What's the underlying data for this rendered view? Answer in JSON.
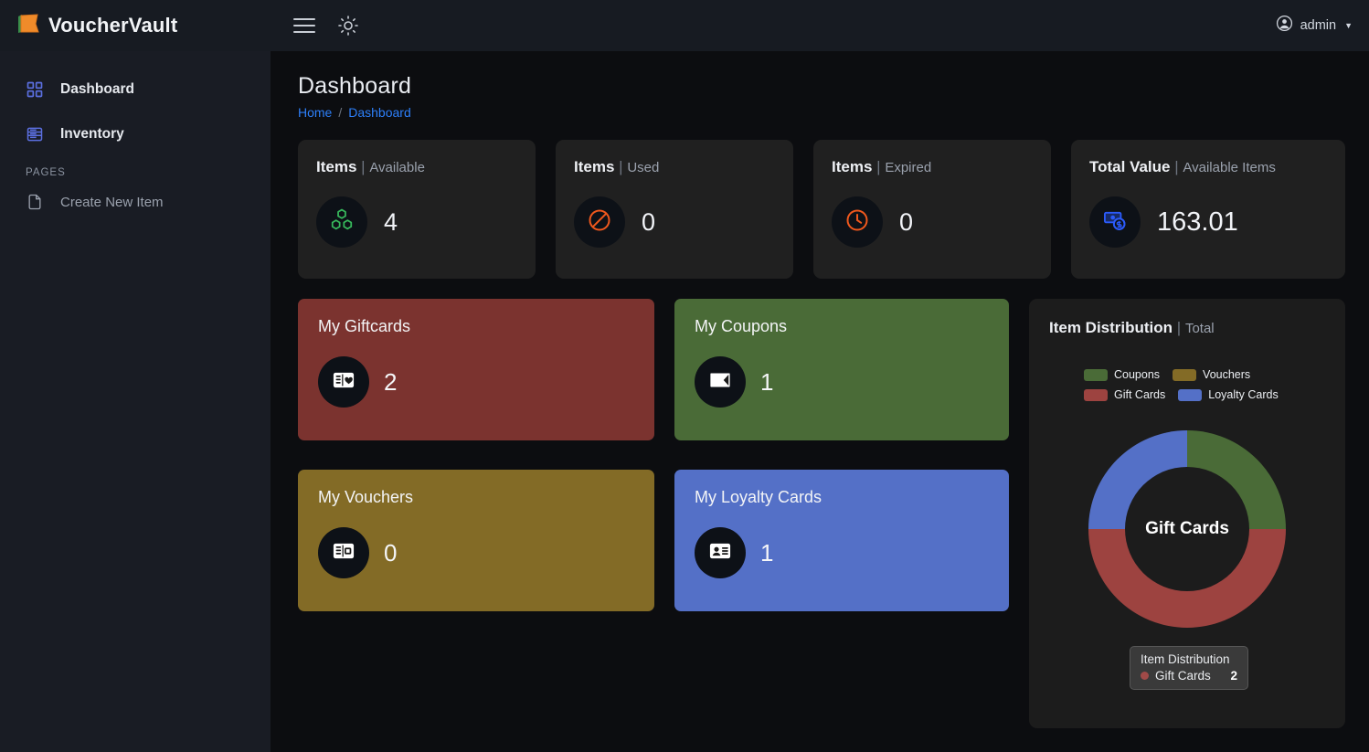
{
  "brand": {
    "logo_icon": "voucher-flag-icon",
    "name": "VoucherVault"
  },
  "topbar": {
    "menu_icon": "hamburger-menu-icon",
    "theme_icon": "sun-theme-icon",
    "user_icon": "user-circle-icon",
    "user_label": "admin",
    "caret_icon": "chevron-down-icon"
  },
  "sidebar": {
    "items": [
      {
        "label": "Dashboard",
        "icon": "grid-dashboard-icon"
      },
      {
        "label": "Inventory",
        "icon": "list-inventory-icon"
      }
    ],
    "section_label": "PAGES",
    "pages": [
      {
        "label": "Create New Item",
        "icon": "file-page-icon"
      }
    ]
  },
  "header": {
    "title": "Dashboard",
    "breadcrumb": [
      "Home",
      "Dashboard"
    ],
    "separator": "/"
  },
  "stats": [
    {
      "title": "Items",
      "bar": "|",
      "subtitle": "Available",
      "value": "4",
      "icon": "cubes-icon",
      "icon_color": "#37b95c"
    },
    {
      "title": "Items",
      "bar": "|",
      "subtitle": "Used",
      "value": "0",
      "icon": "ban-circle-icon",
      "icon_color": "#f0581d"
    },
    {
      "title": "Items",
      "bar": "|",
      "subtitle": "Expired",
      "value": "0",
      "icon": "clock-icon",
      "icon_color": "#f0581d"
    },
    {
      "title": "Total Value",
      "bar": "|",
      "subtitle": "Available Items",
      "value": "163.01",
      "icon": "money-dollar-icon",
      "icon_color": "#2b5bfa"
    }
  ],
  "category_cards": [
    {
      "title": "My Giftcards",
      "value": "2",
      "color": "#7b332f",
      "icon": "giftcard-heart-icon"
    },
    {
      "title": "My Coupons",
      "value": "1",
      "color": "#4a6b37",
      "icon": "coupon-icon"
    },
    {
      "title": "My Vouchers",
      "value": "0",
      "color": "#836b26",
      "icon": "voucher-card-icon"
    },
    {
      "title": "My Loyalty Cards",
      "value": "1",
      "color": "#5470c7",
      "icon": "loyalty-id-card-icon"
    }
  ],
  "chart_panel": {
    "title": "Item Distribution",
    "bar": "|",
    "subtitle": "Total",
    "center_label": "Gift Cards",
    "tooltip": {
      "title": "Item Distribution",
      "series_label": "Gift Cards",
      "value": "2",
      "dot_color": "#a04a48"
    }
  },
  "chart_data": {
    "type": "pie",
    "title": "Item Distribution",
    "subtitle": "Total",
    "legend_position": "top",
    "donut": true,
    "total": 4,
    "categories": [
      "Coupons",
      "Vouchers",
      "Gift Cards",
      "Loyalty Cards"
    ],
    "values": [
      1,
      0,
      2,
      1
    ],
    "colors": [
      "#4a6b37",
      "#836b26",
      "#9d4340",
      "#5470c7"
    ],
    "start_angle_deg": 0,
    "direction": "clockwise",
    "slices": [
      {
        "label": "Coupons",
        "value": 1,
        "percent": 25,
        "color": "#4a6b37",
        "start_deg": 0,
        "end_deg": 90
      },
      {
        "label": "Gift Cards",
        "value": 2,
        "percent": 50,
        "color": "#9d4340",
        "start_deg": 90,
        "end_deg": 270
      },
      {
        "label": "Loyalty Cards",
        "value": 1,
        "percent": 25,
        "color": "#5470c7",
        "start_deg": 270,
        "end_deg": 360
      },
      {
        "label": "Vouchers",
        "value": 0,
        "percent": 0,
        "color": "#836b26",
        "start_deg": 360,
        "end_deg": 360
      }
    ]
  }
}
